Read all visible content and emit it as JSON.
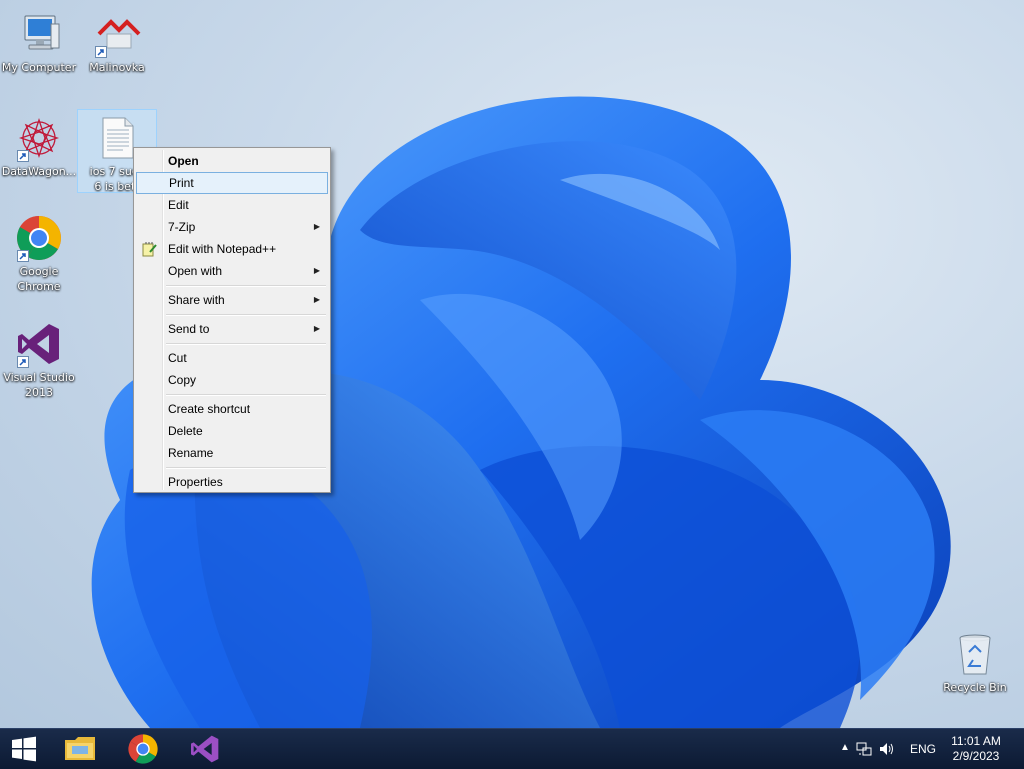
{
  "desktop": {
    "icons": {
      "my_computer": "My Computer",
      "malinovka": "Malinovka",
      "datawagon": "DataWagon...",
      "file_line1": "ios 7 suck",
      "file_line2": "6 is bett",
      "chrome_line1": "Google",
      "chrome_line2": "Chrome",
      "vs_line1": "Visual Studio",
      "vs_line2": "2013",
      "recycle_bin": "Recycle Bin"
    }
  },
  "context_menu": {
    "items": [
      {
        "label": "Open"
      },
      {
        "label": "Print"
      },
      {
        "label": "Edit"
      },
      {
        "label": "7-Zip"
      },
      {
        "label": "Edit with Notepad++"
      },
      {
        "label": "Open with"
      },
      {
        "label": "Share with"
      },
      {
        "label": "Send to"
      },
      {
        "label": "Cut"
      },
      {
        "label": "Copy"
      },
      {
        "label": "Create shortcut"
      },
      {
        "label": "Delete"
      },
      {
        "label": "Rename"
      },
      {
        "label": "Properties"
      }
    ],
    "hovered": "Print"
  },
  "taskbar": {
    "apps": [
      "start-icon",
      "file-explorer-icon",
      "chrome-icon",
      "visual-studio-icon"
    ],
    "tray": {
      "language": "ENG",
      "time": "11:01 AM",
      "date": "2/9/2023"
    }
  },
  "colors": {
    "taskbar": "#0c1a33",
    "menu_bg": "#f0f0f0",
    "menu_hover": "#e5f1fb",
    "menu_hover_border": "#7ab0e0",
    "bloom": "#1f6ff0"
  }
}
